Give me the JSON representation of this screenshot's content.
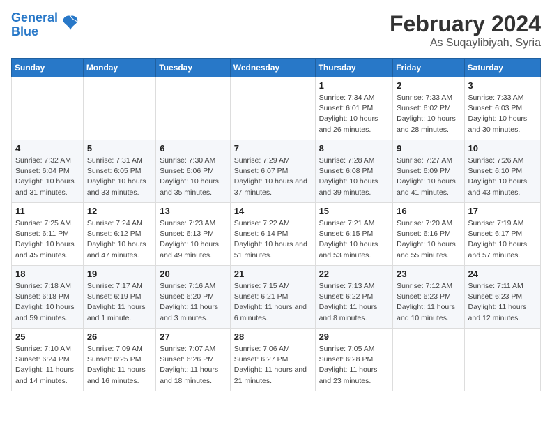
{
  "logo": {
    "line1": "General",
    "line2": "Blue"
  },
  "title": "February 2024",
  "subtitle": "As Suqaylibiyah, Syria",
  "weekdays": [
    "Sunday",
    "Monday",
    "Tuesday",
    "Wednesday",
    "Thursday",
    "Friday",
    "Saturday"
  ],
  "weeks": [
    [
      {
        "day": "",
        "info": ""
      },
      {
        "day": "",
        "info": ""
      },
      {
        "day": "",
        "info": ""
      },
      {
        "day": "",
        "info": ""
      },
      {
        "day": "1",
        "info": "Sunrise: 7:34 AM\nSunset: 6:01 PM\nDaylight: 10 hours\nand 26 minutes."
      },
      {
        "day": "2",
        "info": "Sunrise: 7:33 AM\nSunset: 6:02 PM\nDaylight: 10 hours\nand 28 minutes."
      },
      {
        "day": "3",
        "info": "Sunrise: 7:33 AM\nSunset: 6:03 PM\nDaylight: 10 hours\nand 30 minutes."
      }
    ],
    [
      {
        "day": "4",
        "info": "Sunrise: 7:32 AM\nSunset: 6:04 PM\nDaylight: 10 hours\nand 31 minutes."
      },
      {
        "day": "5",
        "info": "Sunrise: 7:31 AM\nSunset: 6:05 PM\nDaylight: 10 hours\nand 33 minutes."
      },
      {
        "day": "6",
        "info": "Sunrise: 7:30 AM\nSunset: 6:06 PM\nDaylight: 10 hours\nand 35 minutes."
      },
      {
        "day": "7",
        "info": "Sunrise: 7:29 AM\nSunset: 6:07 PM\nDaylight: 10 hours\nand 37 minutes."
      },
      {
        "day": "8",
        "info": "Sunrise: 7:28 AM\nSunset: 6:08 PM\nDaylight: 10 hours\nand 39 minutes."
      },
      {
        "day": "9",
        "info": "Sunrise: 7:27 AM\nSunset: 6:09 PM\nDaylight: 10 hours\nand 41 minutes."
      },
      {
        "day": "10",
        "info": "Sunrise: 7:26 AM\nSunset: 6:10 PM\nDaylight: 10 hours\nand 43 minutes."
      }
    ],
    [
      {
        "day": "11",
        "info": "Sunrise: 7:25 AM\nSunset: 6:11 PM\nDaylight: 10 hours\nand 45 minutes."
      },
      {
        "day": "12",
        "info": "Sunrise: 7:24 AM\nSunset: 6:12 PM\nDaylight: 10 hours\nand 47 minutes."
      },
      {
        "day": "13",
        "info": "Sunrise: 7:23 AM\nSunset: 6:13 PM\nDaylight: 10 hours\nand 49 minutes."
      },
      {
        "day": "14",
        "info": "Sunrise: 7:22 AM\nSunset: 6:14 PM\nDaylight: 10 hours\nand 51 minutes."
      },
      {
        "day": "15",
        "info": "Sunrise: 7:21 AM\nSunset: 6:15 PM\nDaylight: 10 hours\nand 53 minutes."
      },
      {
        "day": "16",
        "info": "Sunrise: 7:20 AM\nSunset: 6:16 PM\nDaylight: 10 hours\nand 55 minutes."
      },
      {
        "day": "17",
        "info": "Sunrise: 7:19 AM\nSunset: 6:17 PM\nDaylight: 10 hours\nand 57 minutes."
      }
    ],
    [
      {
        "day": "18",
        "info": "Sunrise: 7:18 AM\nSunset: 6:18 PM\nDaylight: 10 hours\nand 59 minutes."
      },
      {
        "day": "19",
        "info": "Sunrise: 7:17 AM\nSunset: 6:19 PM\nDaylight: 11 hours\nand 1 minute."
      },
      {
        "day": "20",
        "info": "Sunrise: 7:16 AM\nSunset: 6:20 PM\nDaylight: 11 hours\nand 3 minutes."
      },
      {
        "day": "21",
        "info": "Sunrise: 7:15 AM\nSunset: 6:21 PM\nDaylight: 11 hours\nand 6 minutes."
      },
      {
        "day": "22",
        "info": "Sunrise: 7:13 AM\nSunset: 6:22 PM\nDaylight: 11 hours\nand 8 minutes."
      },
      {
        "day": "23",
        "info": "Sunrise: 7:12 AM\nSunset: 6:23 PM\nDaylight: 11 hours\nand 10 minutes."
      },
      {
        "day": "24",
        "info": "Sunrise: 7:11 AM\nSunset: 6:23 PM\nDaylight: 11 hours\nand 12 minutes."
      }
    ],
    [
      {
        "day": "25",
        "info": "Sunrise: 7:10 AM\nSunset: 6:24 PM\nDaylight: 11 hours\nand 14 minutes."
      },
      {
        "day": "26",
        "info": "Sunrise: 7:09 AM\nSunset: 6:25 PM\nDaylight: 11 hours\nand 16 minutes."
      },
      {
        "day": "27",
        "info": "Sunrise: 7:07 AM\nSunset: 6:26 PM\nDaylight: 11 hours\nand 18 minutes."
      },
      {
        "day": "28",
        "info": "Sunrise: 7:06 AM\nSunset: 6:27 PM\nDaylight: 11 hours\nand 21 minutes."
      },
      {
        "day": "29",
        "info": "Sunrise: 7:05 AM\nSunset: 6:28 PM\nDaylight: 11 hours\nand 23 minutes."
      },
      {
        "day": "",
        "info": ""
      },
      {
        "day": "",
        "info": ""
      }
    ]
  ]
}
